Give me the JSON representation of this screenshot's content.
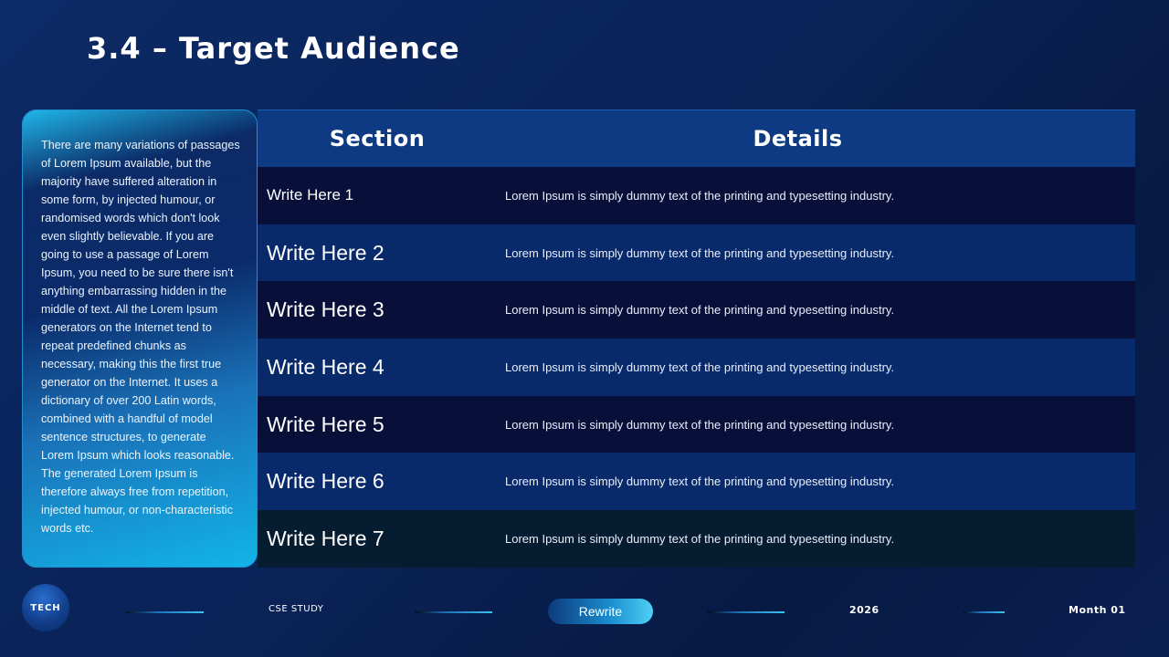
{
  "slide": {
    "title": "3.4 – Target Audience"
  },
  "side_panel": {
    "text": "There are many variations of passages of Lorem Ipsum available, but the majority have suffered alteration in some form, by injected humour, or randomised words which don't look even slightly believable. If you are going to use a passage of Lorem Ipsum, you need to be sure there isn't anything embarrassing hidden in the middle of text. All the Lorem Ipsum generators on the Internet tend to repeat predefined chunks as necessary, making this the first true generator on the Internet. It uses a dictionary of over 200 Latin words, combined with a handful of model sentence structures, to generate Lorem Ipsum which looks reasonable. The generated Lorem Ipsum is therefore always free from repetition, injected humour, or non-characteristic words etc."
  },
  "table": {
    "headers": {
      "section": "Section",
      "details": "Details"
    },
    "rows": [
      {
        "section": "Write Here 1",
        "details": "Lorem Ipsum is simply dummy text of the printing and typesetting industry."
      },
      {
        "section": "Write Here 2",
        "details": "Lorem Ipsum is simply dummy text of the printing and typesetting industry."
      },
      {
        "section": "Write Here 3",
        "details": "Lorem Ipsum is simply dummy text of the printing and typesetting industry."
      },
      {
        "section": "Write Here 4",
        "details": "Lorem Ipsum is simply dummy text of the printing and typesetting industry."
      },
      {
        "section": "Write Here 5",
        "details": "Lorem Ipsum is simply dummy text of the printing and typesetting industry."
      },
      {
        "section": "Write Here 6",
        "details": "Lorem Ipsum is simply dummy text of the printing and typesetting industry."
      },
      {
        "section": "Write Here 7",
        "details": "Lorem Ipsum is simply dummy text of the printing and typesetting industry."
      }
    ]
  },
  "footer": {
    "logo": "TECH",
    "case_study": "CSE STUDY",
    "button": "Rewrite",
    "year": "2026",
    "month": "Month 01"
  },
  "colors": {
    "background": "#0a2358",
    "header_row": "#0d3a82",
    "row_dark": "#080f38",
    "row_blue": "#082a6b",
    "accent": "#1fb6e8"
  }
}
